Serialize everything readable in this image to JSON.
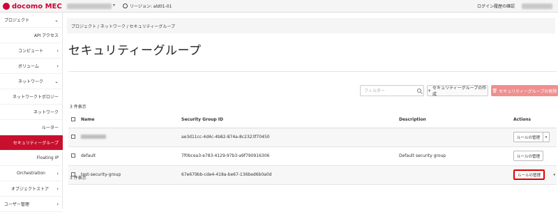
{
  "topbar": {
    "brand": "docomo MEC",
    "region_label": "リージョン: ald01-01",
    "login_history": "ログイン履歴の確認"
  },
  "sidebar": {
    "items": [
      {
        "label": "プロジェクト"
      },
      {
        "label": "API アクセス"
      },
      {
        "label": "コンピュート"
      },
      {
        "label": "ボリューム"
      },
      {
        "label": "ネットワーク"
      },
      {
        "label": "ネットワークトポロジー"
      },
      {
        "label": "ネットワーク"
      },
      {
        "label": "ルーター"
      },
      {
        "label": "セキュリティーグループ"
      },
      {
        "label": "Floating IP"
      },
      {
        "label": "Orchestration"
      },
      {
        "label": "オブジェクトストア"
      },
      {
        "label": "ユーザー管理"
      }
    ]
  },
  "breadcrumb": "プロジェクト / ネットワーク / セキュリティーグループ",
  "page_title": "セキュリティーグループ",
  "toolbar": {
    "filter_placeholder": "フィルター",
    "create_label": "セキュリティーグループの作成",
    "delete_label": "セキュリティーグループの削除"
  },
  "table": {
    "count_top": "3 件表示",
    "count_bottom": "3 件表示",
    "headers": {
      "name": "Name",
      "sgid": "Security Group ID",
      "desc": "Description",
      "actions": "Actions"
    },
    "rows": [
      {
        "name": "",
        "id": "ae3d11cc-4d4c-4b82-874a-8c2323f70450",
        "description": "",
        "action": "ルールの管理"
      },
      {
        "name": "default",
        "id": "7f0bcea3-e783-4129-97b3-a9f790916306",
        "description": "Default security group",
        "action": "ルールの管理"
      },
      {
        "name": "test-security-group",
        "id": "67e679bb-cde4-418a-be67-136bed6b0a0d",
        "description": "",
        "action": "ルールの管理"
      }
    ]
  },
  "colors": {
    "brand": "#cc0033",
    "active_nav": "#c8102e",
    "delete_button": "#ef8f8f",
    "highlight_border": "#e00000"
  }
}
